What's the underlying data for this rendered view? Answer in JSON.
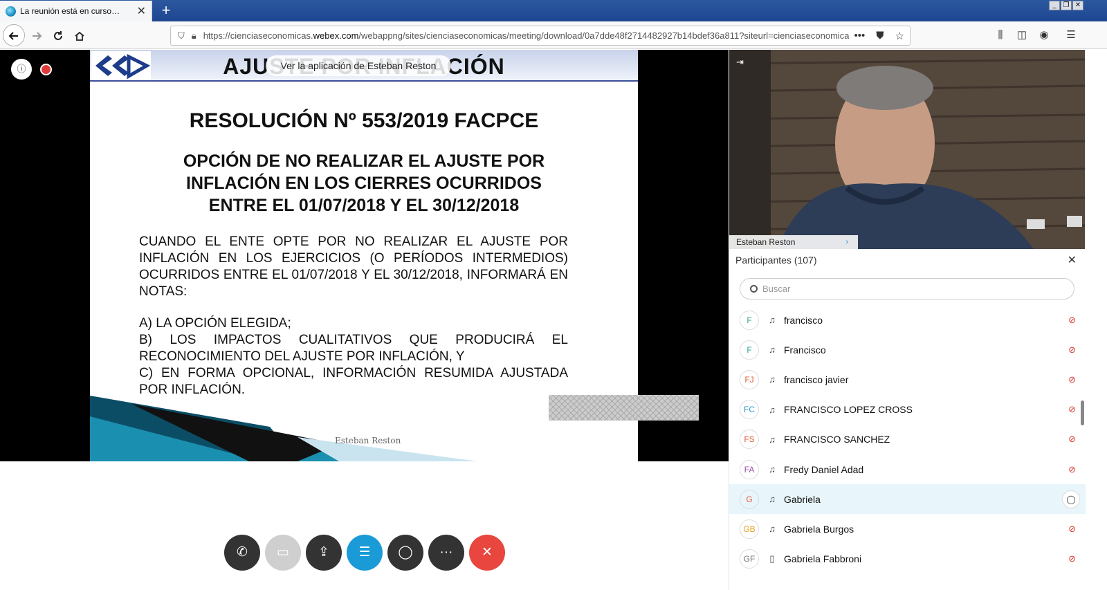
{
  "browser": {
    "tab_title": "La reunión está en curso…",
    "tab_close": "✕",
    "new_tab": "+",
    "window_controls": [
      "_",
      "❐",
      "✕"
    ],
    "url_prefix": "https://cienciaseconomicas.",
    "url_domain": "webex.com",
    "url_rest": "/webappng/sites/cienciaseconomicas/meeting/download/0a7dde48f2714482927b14bdef36a811?siteurl=cienciaseconomicas&",
    "url_more": "•••"
  },
  "slide": {
    "header_title": "AJUSTE POR INFLACIÓN",
    "app_pill": "Ver la aplicación de Esteban Reston",
    "resolution": "RESOLUCIÓN Nº 553/2019 FACPCE",
    "option_lines": [
      "OPCIÓN DE NO REALIZAR EL AJUSTE POR",
      "INFLACIÓN EN LOS CIERRES OCURRIDOS",
      "ENTRE EL 01/07/2018 Y EL 30/12/2018"
    ],
    "body": "CUANDO EL ENTE OPTE POR NO REALIZAR EL AJUSTE POR INFLACIÓN EN LOS EJERCICIOS (O PERÍODOS INTERMEDIOS) OCURRIDOS ENTRE EL 01/07/2018 Y EL 30/12/2018,  INFORMARÁ EN NOTAS:",
    "items": [
      "A)    LA OPCIÓN ELEGIDA;",
      "B)  LOS IMPACTOS CUALITATIVOS QUE PRODUCIRÁ EL RECONOCIMIENTO DEL AJUSTE POR INFLACIÓN, Y",
      "C)   EN FORMA OPCIONAL, INFORMACIÓN RESUMIDA AJUSTADA POR INFLACIÓN."
    ],
    "credit": "Esteban Reston"
  },
  "video": {
    "name": "Esteban Reston",
    "collapse_icon": "⇥"
  },
  "participants": {
    "header": "Participantes (107)",
    "close": "✕",
    "search_placeholder": "Buscar",
    "list": [
      {
        "initials": "F",
        "name": "francisco",
        "color": "#2aa58a",
        "device": "headset",
        "muted": true
      },
      {
        "initials": "F",
        "name": "Francisco",
        "color": "#2aa58a",
        "device": "headset",
        "muted": true
      },
      {
        "initials": "FJ",
        "name": "francisco javier",
        "color": "#e0603a",
        "device": "headset",
        "muted": true
      },
      {
        "initials": "FC",
        "name": "FRANCISCO LOPEZ CROSS",
        "color": "#2a9ac9",
        "device": "headset",
        "muted": true
      },
      {
        "initials": "FS",
        "name": "FRANCISCO SANCHEZ",
        "color": "#e0603a",
        "device": "headset",
        "muted": true
      },
      {
        "initials": "FA",
        "name": "Fredy Daniel Adad",
        "color": "#9b4fa8",
        "device": "headset",
        "muted": true
      },
      {
        "initials": "G",
        "name": "Gabriela",
        "color": "#e0603a",
        "device": "headset",
        "muted": false,
        "chat": true
      },
      {
        "initials": "GB",
        "name": "Gabriela Burgos",
        "color": "#e6a21c",
        "device": "headset",
        "muted": true
      },
      {
        "initials": "GF",
        "name": "Gabriela Fabbroni",
        "color": "#777777",
        "device": "phone",
        "muted": true
      }
    ]
  },
  "controls": [
    {
      "name": "phone-audio",
      "icon": "✆",
      "color": "#333333"
    },
    {
      "name": "video-off",
      "icon": "▭",
      "color": "#cfcfcf"
    },
    {
      "name": "share",
      "icon": "⇪",
      "color": "#333333"
    },
    {
      "name": "participants",
      "icon": "☰",
      "color": "#1a9ad6"
    },
    {
      "name": "chat",
      "icon": "◯",
      "color": "#333333"
    },
    {
      "name": "more",
      "icon": "···",
      "color": "#333333"
    },
    {
      "name": "leave",
      "icon": "✕",
      "color": "#e8463f"
    }
  ]
}
